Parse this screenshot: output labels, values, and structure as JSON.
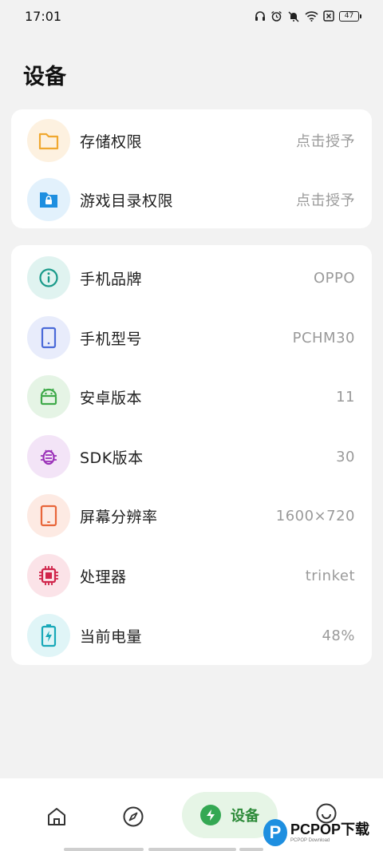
{
  "status_bar": {
    "time": "17:01",
    "battery": "47"
  },
  "page": {
    "title": "设备"
  },
  "permissions": [
    {
      "label": "存储权限",
      "value": "点击授予",
      "icon": "folder-icon",
      "color": "#f0a830",
      "bg": "#fdf1e0"
    },
    {
      "label": "游戏目录权限",
      "value": "点击授予",
      "icon": "locked-folder-icon",
      "color": "#1e8fe0",
      "bg": "#e2f1fc"
    }
  ],
  "device_info": [
    {
      "label": "手机品牌",
      "value": "OPPO",
      "icon": "info-icon",
      "color": "#1a9a8a",
      "bg": "#e0f3f0"
    },
    {
      "label": "手机型号",
      "value": "PCHM30",
      "icon": "phone-icon",
      "color": "#4a6ad8",
      "bg": "#e8ecfb"
    },
    {
      "label": "安卓版本",
      "value": "11",
      "icon": "android-icon",
      "color": "#3faa4a",
      "bg": "#e5f4e5"
    },
    {
      "label": "SDK版本",
      "value": "30",
      "icon": "bug-icon",
      "color": "#9a30b8",
      "bg": "#f3e4f7"
    },
    {
      "label": "屏幕分辨率",
      "value": "1600×720",
      "icon": "tablet-icon",
      "color": "#e8663a",
      "bg": "#fdeae3"
    },
    {
      "label": "处理器",
      "value": "trinket",
      "icon": "chip-icon",
      "color": "#d0244a",
      "bg": "#fbe3e8"
    },
    {
      "label": "当前电量",
      "value": "48%",
      "icon": "battery-charging-icon",
      "color": "#18a8b8",
      "bg": "#e0f5f7"
    }
  ],
  "bottom_nav": {
    "items": [
      {
        "icon": "home-icon"
      },
      {
        "icon": "compass-icon"
      },
      {
        "icon": "lightning-icon",
        "label": "设备",
        "active": true
      },
      {
        "icon": "smile-icon"
      }
    ]
  },
  "watermark": {
    "logo": "P",
    "main": "PCPOP下载",
    "sub": "PCPOP Download"
  }
}
